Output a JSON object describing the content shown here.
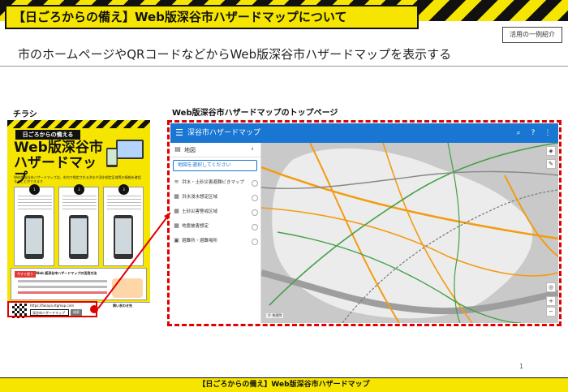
{
  "slide": {
    "title": "【日ごろからの備え】Web版深谷市ハザードマップについて",
    "tag": "活用の一例紹介",
    "subtitle": "市のホームページやQRコードなどからWeb版深谷市ハザードマップを表示する",
    "flyer_section": "チラシ",
    "map_section": "Web版深谷市ハザードマップのトップページ",
    "page_number": "1",
    "footer": "【日ごろからの備え】Web版深谷市ハザードマップ"
  },
  "flyer": {
    "tag": "日ごろからの備える",
    "title_line1": "Web版深谷市",
    "title_line2": "ハザードマップ",
    "body": "Web版深谷市ハザードマップは、市内で想定される洪水や浸水想定区域等の情報を確認することができます",
    "howto_label": "今すぐ使う",
    "howto_title": "Web 版深谷市ハザードマップの活用方法",
    "url": "https://fukaya.stgmap.com",
    "search_text": "深谷市ハザードマップ",
    "search_button": "検索",
    "contact": "問い合わせ先"
  },
  "app": {
    "title": "深谷市ハザードマップ",
    "panel_label": "地図",
    "search_placeholder": "地図を選択してください",
    "layers": [
      {
        "icon": "flood-icon",
        "label": "洪水・土砂災害避難ビきマップ"
      },
      {
        "icon": "inundation-icon",
        "label": "洪水浸水想定区域"
      },
      {
        "icon": "landslide-icon",
        "label": "土砂災害警戒区域"
      },
      {
        "icon": "earthquake-icon",
        "label": "地震被害想定"
      },
      {
        "icon": "shelter-icon",
        "label": "避難所・避難場所"
      }
    ],
    "map_credit": "© 地理院"
  }
}
